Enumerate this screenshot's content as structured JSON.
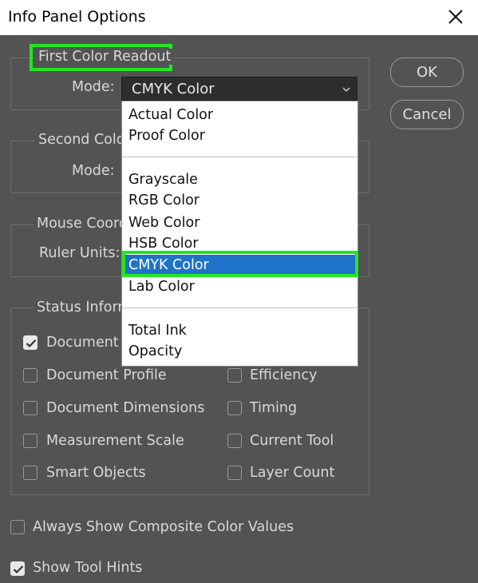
{
  "window": {
    "title": "Info Panel Options"
  },
  "first_readout": {
    "legend": "First Color Readout",
    "mode_label": "Mode:",
    "selected": "CMYK Color"
  },
  "second_readout": {
    "legend": "Second Color",
    "mode_label": "Mode:"
  },
  "mouse_coords": {
    "legend": "Mouse Coord",
    "ruler_label": "Ruler Units:"
  },
  "status_info": {
    "legend": "Status Inform",
    "items": [
      {
        "label": "Document S",
        "checked": true
      },
      {
        "label": "Document Profile",
        "checked": false
      },
      {
        "label": "Document Dimensions",
        "checked": false
      },
      {
        "label": "Measurement Scale",
        "checked": false
      },
      {
        "label": "Smart Objects",
        "checked": false
      },
      {
        "label": "Efficiency",
        "checked": false
      },
      {
        "label": "Timing",
        "checked": false
      },
      {
        "label": "Current Tool",
        "checked": false
      },
      {
        "label": "Layer Count",
        "checked": false
      }
    ]
  },
  "dropdown": {
    "options": [
      "Actual Color",
      "Proof Color",
      "Grayscale",
      "RGB Color",
      "Web Color",
      "HSB Color",
      "CMYK Color",
      "Lab Color",
      "Total Ink",
      "Opacity"
    ],
    "selected_index": 6
  },
  "buttons": {
    "ok": "OK",
    "cancel": "Cancel"
  },
  "bottom": {
    "composite": {
      "label": "Always Show Composite Color Values",
      "checked": false
    },
    "tool_hints": {
      "label": "Show Tool Hints",
      "checked": true
    }
  },
  "colors": {
    "background": "#535353",
    "highlight": "#22e622",
    "selection": "#1e73c8"
  }
}
